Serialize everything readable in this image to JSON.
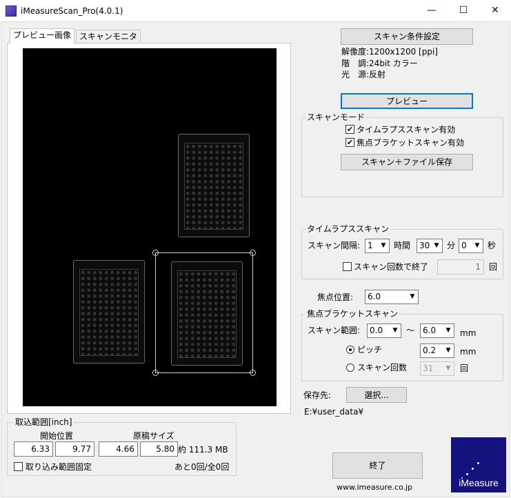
{
  "window": {
    "title": "iMeasureScan_Pro(4.0.1)",
    "minimize": "—",
    "maximize": "☐",
    "close": "✕"
  },
  "tabs": [
    {
      "label": "プレビュー画像",
      "active": true
    },
    {
      "label": "スキャンモニタ",
      "active": false
    }
  ],
  "scan_settings": {
    "button": "スキャン条件設定",
    "resolution": "解像度:1200x1200 [ppi]",
    "tone": "階　調:24bit カラー",
    "light": "光　源:反射"
  },
  "preview_button": "プレビュー",
  "scan_mode": {
    "label": "スキャンモード",
    "timelapse_enabled": "タイムラプススキャン有効",
    "focus_bracket_enabled": "焦点ブラケットスキャン有効",
    "scan_save_button": "スキャン＋ファイル保存"
  },
  "timelapse": {
    "label": "タイムラプススキャン",
    "interval_label": "スキャン間隔:",
    "hours": "1",
    "hours_unit": "時間",
    "minutes": "30",
    "minutes_unit": "分",
    "seconds": "0",
    "seconds_unit": "秒",
    "end_by_count_label": "スキャン回数で終了",
    "count_value": "1",
    "count_unit": "回"
  },
  "focus": {
    "position_label": "焦点位置:",
    "position_value": "6.0"
  },
  "focus_bracket": {
    "label": "焦点ブラケットスキャン",
    "range_label": "スキャン範囲:",
    "range_from": "0.0",
    "tilde": "～",
    "range_to": "6.0",
    "range_unit": "mm",
    "pitch_label": "ピッチ",
    "pitch_value": "0.2",
    "pitch_unit": "mm",
    "count_label": "スキャン回数",
    "count_value": "31",
    "count_unit": "回"
  },
  "save": {
    "label": "保存先:",
    "select_button": "選択...",
    "path": "E:¥user_data¥"
  },
  "capture_range": {
    "label": "取込範囲[inch]",
    "start_label": "開始位置",
    "start_x": "6.33",
    "start_y": "9.77",
    "size_label": "原稿サイズ",
    "size_w": "4.66",
    "size_h": "5.80",
    "approx_size": "約 111.3 MB",
    "fix_range_label": "取り込み範囲固定",
    "remaining": "あと0回/全0回"
  },
  "exit_button": "終了",
  "website": "www.imeasure.co.jp",
  "logo_text": "iMeasure",
  "colors": {
    "accent": "#0078d7",
    "logo_bg": "#13127f",
    "preview_bg": "#000000"
  }
}
